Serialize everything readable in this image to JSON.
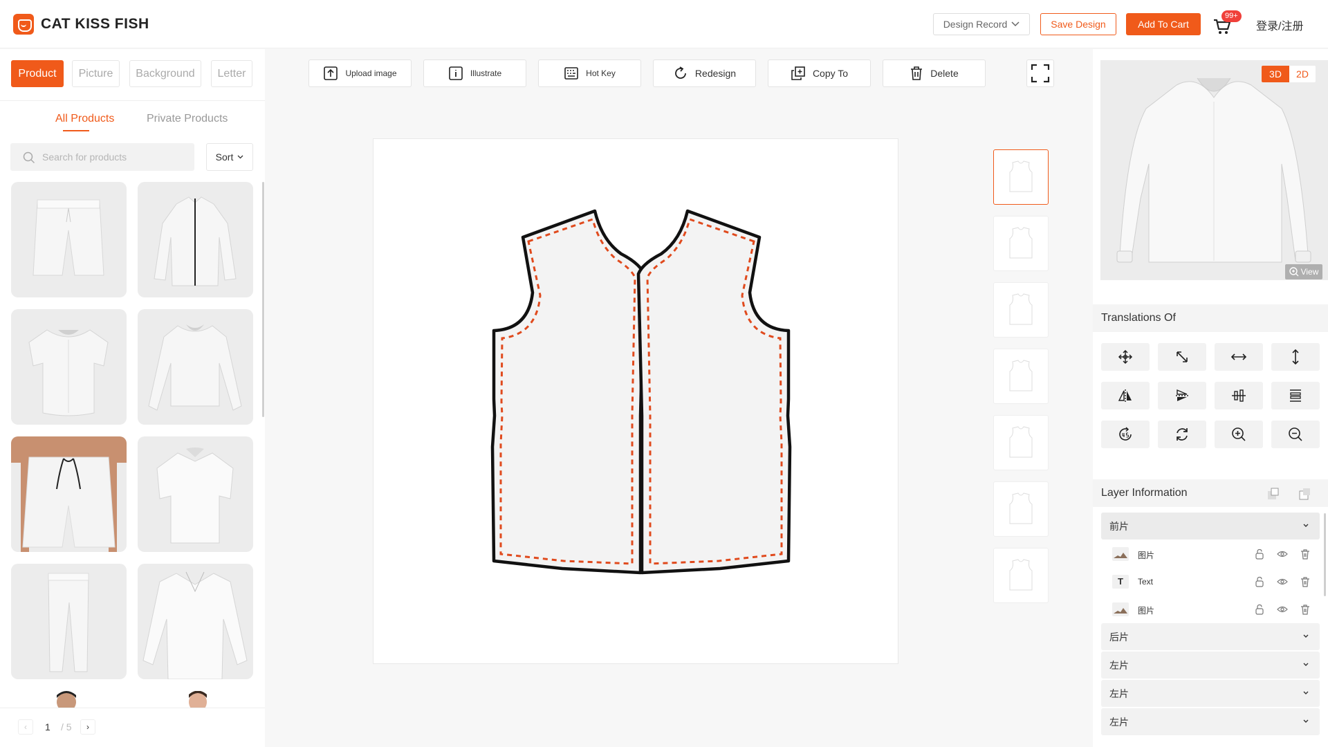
{
  "header": {
    "brand": "CAT KISS FISH",
    "design_record": "Design Record",
    "save_design": "Save Design",
    "add_to_cart": "Add To Cart",
    "cart_badge": "99+",
    "login": "登录/注册"
  },
  "left_panel": {
    "tabs": [
      "Product",
      "Picture",
      "Background",
      "Letter"
    ],
    "sub_tabs": [
      "All Products",
      "Private Products"
    ],
    "search_placeholder": "Search for products",
    "sort_label": "Sort",
    "products": [
      {
        "name": "shorts"
      },
      {
        "name": "zip-jacket"
      },
      {
        "name": "baseball-shirt"
      },
      {
        "name": "bomber-jacket"
      },
      {
        "name": "drawstring-shorts"
      },
      {
        "name": "short-sleeve-shirt"
      },
      {
        "name": "pants"
      },
      {
        "name": "long-sleeve-shirt"
      }
    ],
    "pager": {
      "prev": "‹",
      "current": "1",
      "total": "/ 5",
      "next": "›"
    }
  },
  "toolbar": {
    "upload_image": "Upload image",
    "illustrate": "Illustrate",
    "hot_key": "Hot Key",
    "redesign": "Redesign",
    "copy_to": "Copy To",
    "delete": "Delete"
  },
  "right_panel": {
    "toggle_3d": "3D",
    "toggle_2d": "2D",
    "view_label": "View",
    "translations_title": "Translations Of",
    "layer_info_title": "Layer Information",
    "layer_groups": [
      {
        "name": "前片",
        "open": true,
        "layers": [
          {
            "type": "image",
            "name": "图片"
          },
          {
            "type": "text",
            "name": "Text"
          },
          {
            "type": "image",
            "name": "图片"
          }
        ]
      },
      {
        "name": "后片",
        "open": false
      },
      {
        "name": "左片",
        "open": false
      },
      {
        "name": "左片",
        "open": false
      },
      {
        "name": "左片",
        "open": false
      }
    ]
  },
  "colors": {
    "accent": "#f05a1a",
    "badge": "#f0403a",
    "panel_bg": "#f7f7f7"
  },
  "icons": [
    "cat-logo-icon",
    "chevron-down-icon",
    "cart-icon",
    "search-icon",
    "upload-icon",
    "info-icon",
    "keyboard-icon",
    "redo-icon",
    "copy-icon",
    "trash-icon",
    "fullscreen-icon",
    "zoom-in-icon",
    "move-icon",
    "resize-icon",
    "flip-horizontal-icon",
    "flip-vertical-icon",
    "mirror-h-icon",
    "mirror-v-icon",
    "align-center-h-icon",
    "align-center-v-icon",
    "rotate-45-icon",
    "rotate-icon",
    "zoom-out-icon",
    "lock-icon",
    "eye-icon",
    "layer-add-icon",
    "layer-copy-icon"
  ]
}
